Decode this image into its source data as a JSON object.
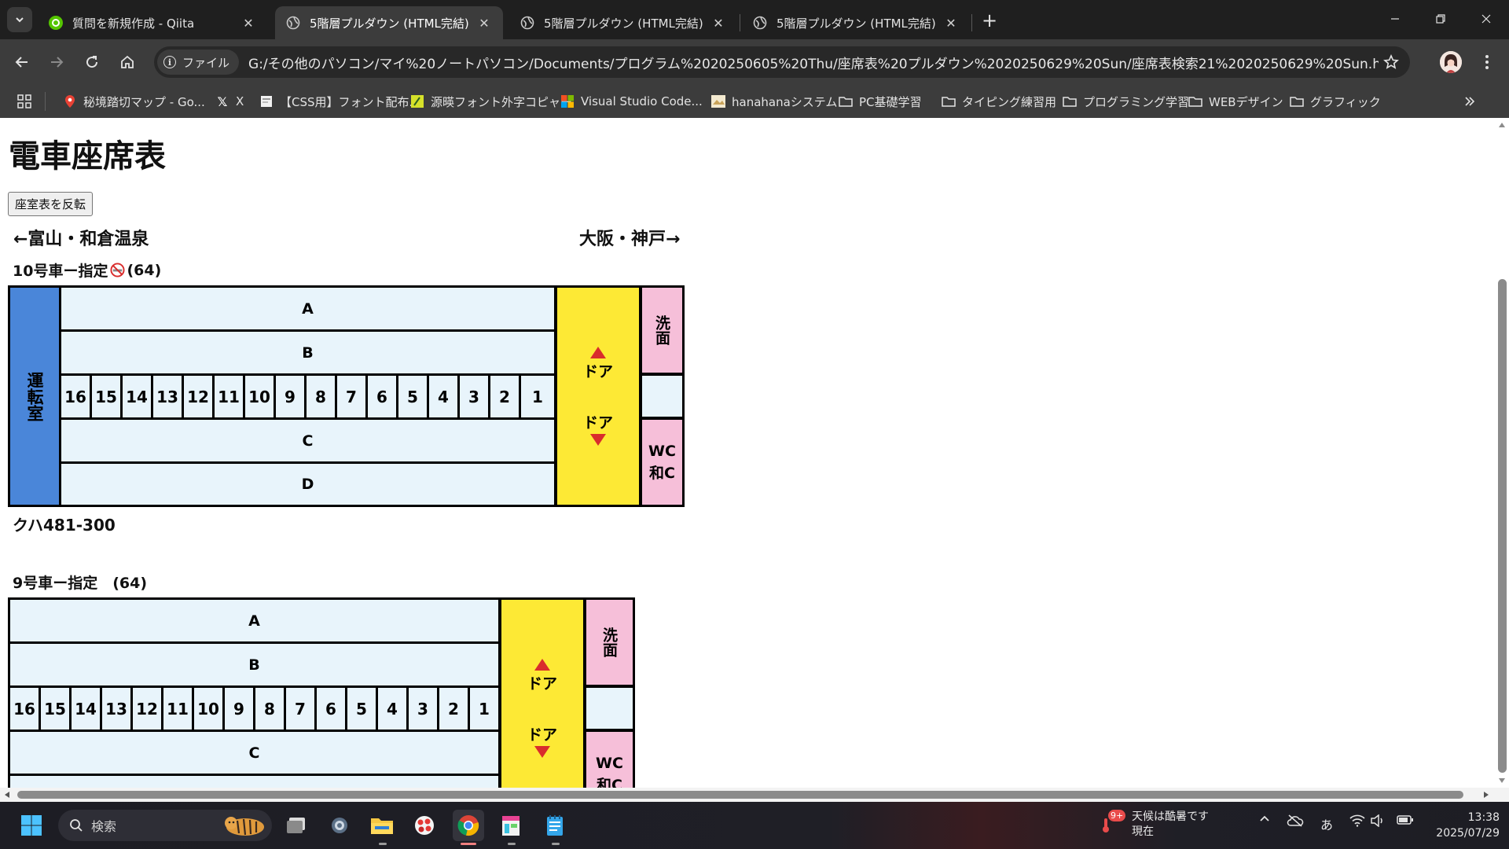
{
  "browser": {
    "tabs": [
      {
        "title": "質問を新規作成 - Qiita",
        "active": false
      },
      {
        "title": "5階層プルダウン (HTML完結)",
        "active": true
      },
      {
        "title": "5階層プルダウン (HTML完結)",
        "active": false
      },
      {
        "title": "5階層プルダウン (HTML完結)",
        "active": false
      }
    ],
    "file_chip": "ファイル",
    "url": "G:/その他のパソコン/マイ%20ノートパソコン/Documents/プログラム%2020250605%20Thu/座席表%20プルダウン%2020250629%20Sun/座席表検索21%2020250629%20Sun.html"
  },
  "bookmarks": [
    {
      "label": "秘境踏切マップ - Go...",
      "icon": "map-pin-icon"
    },
    {
      "label": "X",
      "icon": "x-logo-icon"
    },
    {
      "label": "【CSS用】フォント配布...",
      "icon": "page-icon"
    },
    {
      "label": "源暎フォント外字コピャー",
      "icon": "font-icon"
    },
    {
      "label": "Visual Studio Code...",
      "icon": "microsoft-icon"
    },
    {
      "label": "hanahanaシステム",
      "icon": "page-icon"
    },
    {
      "label": "PC基礎学習",
      "icon": "folder-icon"
    },
    {
      "label": "タイピング練習用",
      "icon": "folder-icon"
    },
    {
      "label": "プログラミング学習",
      "icon": "folder-icon"
    },
    {
      "label": "WEBデザイン",
      "icon": "folder-icon"
    },
    {
      "label": "グラフィック",
      "icon": "folder-icon"
    }
  ],
  "page": {
    "title": "電車座席表",
    "flip_button": "座室表を反転",
    "direction_left": "←富山・和倉温泉",
    "direction_right": "大阪・神戸→"
  },
  "cars": [
    {
      "label": "10号車ー指定",
      "no_smoking": true,
      "capacity": "(64)",
      "cab": "運転室",
      "rows": [
        "A",
        "B",
        "C",
        "D"
      ],
      "seats": [
        "16",
        "15",
        "14",
        "13",
        "12",
        "11",
        "10",
        "9",
        "8",
        "7",
        "6",
        "5",
        "4",
        "3",
        "2",
        "1"
      ],
      "door_top": "ドア",
      "door_bottom": "ドア",
      "wash": "洗面",
      "wc_1": "WC",
      "wc_2": "和C",
      "model": "クハ481-300"
    },
    {
      "label": "9号車ー指定　(64)",
      "rows": [
        "A",
        "B",
        "C"
      ],
      "seats": [
        "16",
        "15",
        "14",
        "13",
        "12",
        "11",
        "10",
        "9",
        "8",
        "7",
        "6",
        "5",
        "4",
        "3",
        "2",
        "1"
      ],
      "door_top": "ドア",
      "door_bottom": "ドア",
      "wash": "洗面",
      "wc_1": "WC",
      "wc_2": "和C"
    }
  ],
  "taskbar": {
    "search_placeholder": "検索",
    "weather_line1": "天候は酷暑です",
    "weather_line2": "現在",
    "weather_badge": "9+",
    "ime": "あ",
    "time": "13:38",
    "date": "2025/07/29"
  },
  "colors": {
    "cab": "#4a86d9",
    "seat": "#e8f4fb",
    "door": "#fde935",
    "facility": "#f6bfd9",
    "arrow": "#d92c2c"
  }
}
